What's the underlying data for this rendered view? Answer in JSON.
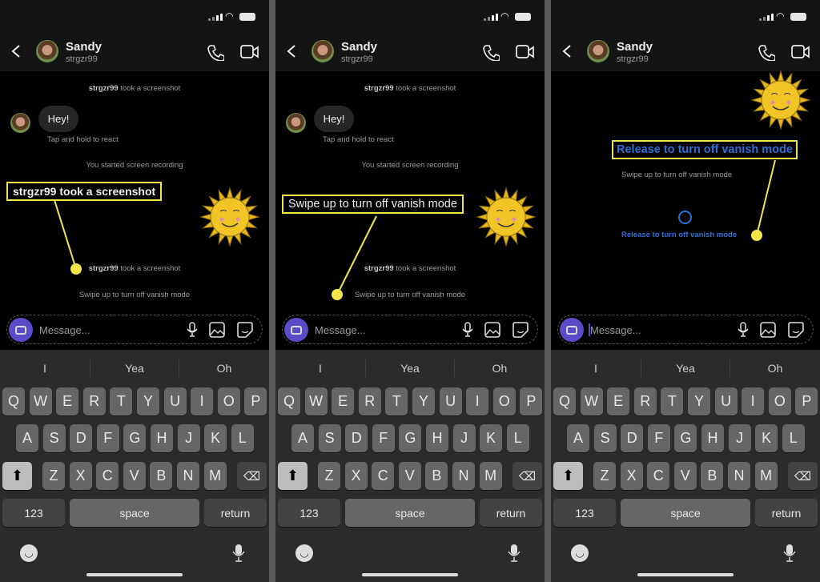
{
  "header": {
    "name": "Sandy",
    "username": "strgzr99"
  },
  "composer": {
    "placeholder": "Message..."
  },
  "keyboard": {
    "suggestions": [
      "I",
      "Yea",
      "Oh"
    ],
    "row1": [
      "Q",
      "W",
      "E",
      "R",
      "T",
      "Y",
      "U",
      "I",
      "O",
      "P"
    ],
    "row2": [
      "A",
      "S",
      "D",
      "F",
      "G",
      "H",
      "J",
      "K",
      "L"
    ],
    "row3": [
      "Z",
      "X",
      "C",
      "V",
      "B",
      "N",
      "M"
    ],
    "numbers": "123",
    "space": "space",
    "return": "return"
  },
  "panels": [
    {
      "notice_user": "strgzr99",
      "notice_text": " took a screenshot",
      "bubble": "Hey!",
      "hint": "Tap and hold to react",
      "recording": "You started screen recording",
      "callout": "strgzr99 took a screenshot",
      "notice2_user": "strgzr99",
      "notice2_text": " took a screenshot",
      "vanish": "Swipe up to turn off vanish mode"
    },
    {
      "notice_user": "strgzr99",
      "notice_text": " took a screenshot",
      "bubble": "Hey!",
      "hint": "Tap and hold to react",
      "recording": "You started screen recording",
      "callout": "Swipe up to turn off vanish mode",
      "notice2_user": "strgzr99",
      "notice2_text": " took a screenshot",
      "vanish": "Swipe up to turn off vanish mode"
    },
    {
      "callout": "Release to turn off vanish mode",
      "swipe": "Swipe up to turn off vanish mode",
      "release": "Release to turn off vanish mode"
    }
  ],
  "colors": {
    "callout": "#f3e54a",
    "accent_blue": "#2f6fd6",
    "camera_button": "#5a4bc8",
    "keyboard_bg": "#2b2b2d"
  }
}
